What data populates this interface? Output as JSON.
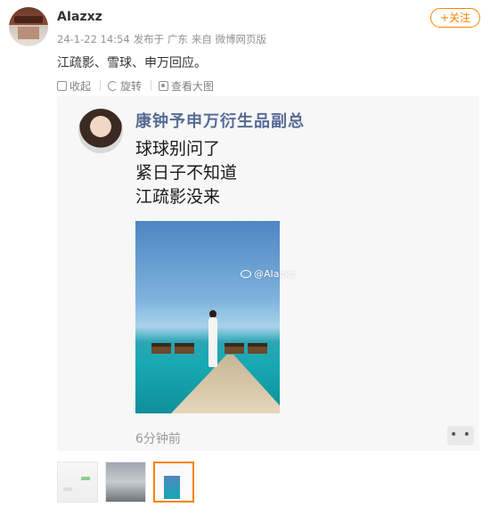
{
  "post": {
    "username": "AIazxz",
    "date": "24-1-22 14:54",
    "posted_from": "发布于 广东",
    "source": "来自 微博网页版",
    "follow_label": "+关注",
    "text": "江疏影、雪球、申万回应。"
  },
  "toolbar": {
    "collapse_label": "收起",
    "rotate_label": "旋转",
    "view_large_label": "查看大图"
  },
  "image_card": {
    "name": "康钟予申万衍生品副总",
    "lines": [
      "球球别问了",
      "紧日子不知道",
      "江疏影没来"
    ],
    "watermark": "@AIazxz",
    "time_ago": "6分钟前",
    "more_label": "• •"
  },
  "colors": {
    "accent": "#ff8200",
    "link": "#576b95",
    "meta_gray": "#939393"
  },
  "thumbnails": [
    {
      "name": "thumbnail-1"
    },
    {
      "name": "thumbnail-2"
    },
    {
      "name": "thumbnail-3",
      "selected": true
    }
  ]
}
